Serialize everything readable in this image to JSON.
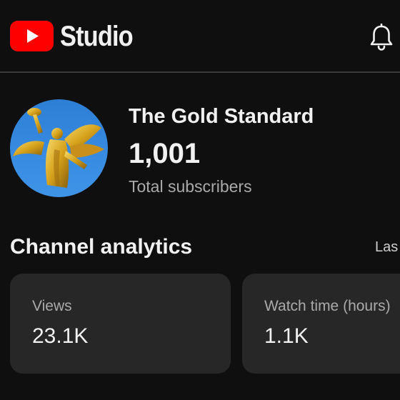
{
  "header": {
    "app_name": "Studio",
    "logo_icon": "youtube-play-icon",
    "notifications_icon": "bell-icon",
    "brand_color": "#ff0000"
  },
  "channel": {
    "name": "The Gold Standard",
    "subscriber_count": "1,001",
    "subscriber_label": "Total subscribers"
  },
  "analytics": {
    "title": "Channel analytics",
    "period_label": "Las",
    "cards": [
      {
        "label": "Views",
        "value": "23.1K"
      },
      {
        "label": "Watch time (hours)",
        "value": "1.1K"
      }
    ]
  }
}
